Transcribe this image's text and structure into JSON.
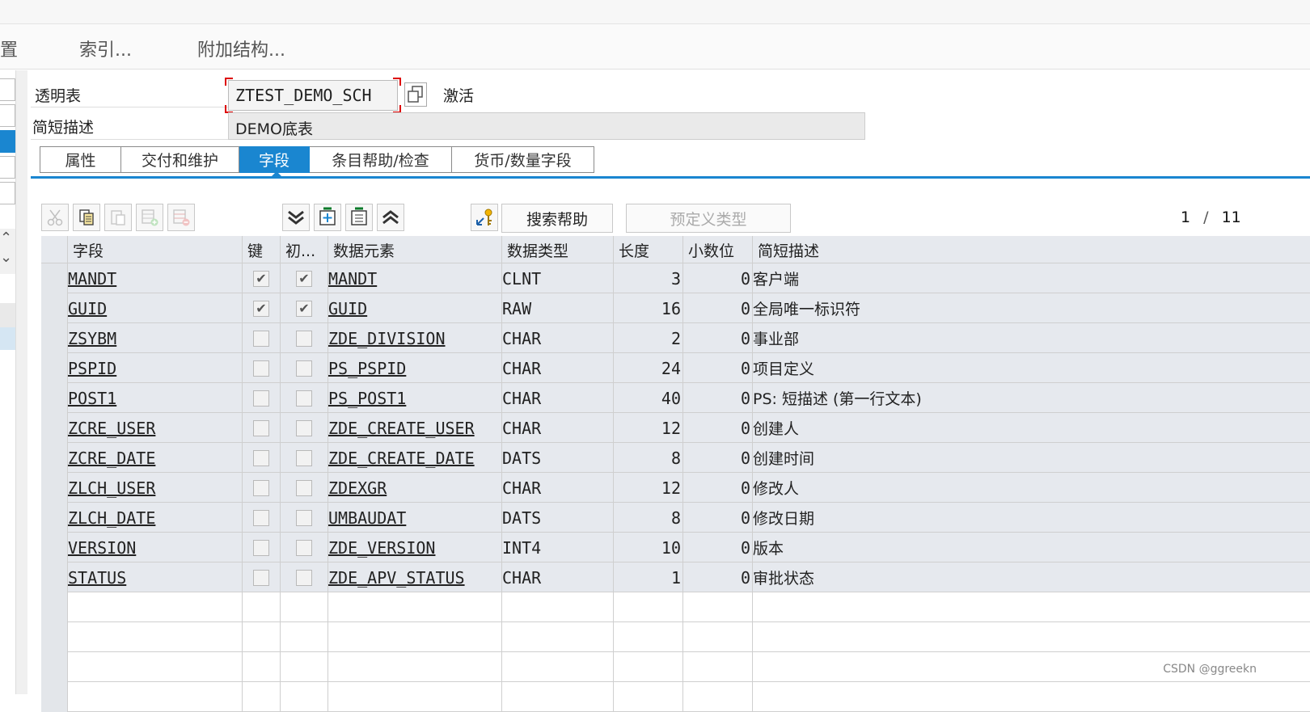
{
  "menu": {
    "items": [
      "置",
      "索引...",
      "附加结构..."
    ]
  },
  "header": {
    "table_label": "透明表",
    "table_name": "ZTEST_DEMO_SCH",
    "status": "激活",
    "desc_label": "简短描述",
    "desc_value": "DEMO底表"
  },
  "tabs": [
    "属性",
    "交付和维护",
    "字段",
    "条目帮助/检查",
    "货币/数量字段"
  ],
  "active_tab": "字段",
  "toolbar": {
    "icons": [
      "cut-icon",
      "copy-icon",
      "paste-icon",
      "insert-row-icon",
      "delete-row-icon",
      "scroll-bottom-icon",
      "new-field-icon",
      "details-icon",
      "scroll-top-icon",
      "foreign-key-icon"
    ],
    "search_help": "搜索帮助",
    "predefined_type": "预定义类型",
    "page_current": "1",
    "page_sep": "/",
    "page_total": "11"
  },
  "columns": [
    "字段",
    "键",
    "初...",
    "数据元素",
    "数据类型",
    "长度",
    "小数位",
    "简短描述"
  ],
  "rows": [
    {
      "field": "MANDT",
      "key": true,
      "init": true,
      "element": "MANDT",
      "type": "CLNT",
      "length": "3",
      "decimals": "0",
      "desc": "客户端"
    },
    {
      "field": "GUID",
      "key": true,
      "init": true,
      "element": "GUID",
      "type": "RAW",
      "length": "16",
      "decimals": "0",
      "desc": "全局唯一标识符"
    },
    {
      "field": "ZSYBM",
      "key": false,
      "init": false,
      "element": "ZDE_DIVISION",
      "type": "CHAR",
      "length": "2",
      "decimals": "0",
      "desc": "事业部"
    },
    {
      "field": "PSPID",
      "key": false,
      "init": false,
      "element": "PS_PSPID",
      "type": "CHAR",
      "length": "24",
      "decimals": "0",
      "desc": "项目定义"
    },
    {
      "field": "POST1",
      "key": false,
      "init": false,
      "element": "PS_POST1",
      "type": "CHAR",
      "length": "40",
      "decimals": "0",
      "desc": "PS: 短描述 (第一行文本)"
    },
    {
      "field": "ZCRE_USER",
      "key": false,
      "init": false,
      "element": "ZDE_CREATE_USER",
      "type": "CHAR",
      "length": "12",
      "decimals": "0",
      "desc": "创建人"
    },
    {
      "field": "ZCRE_DATE",
      "key": false,
      "init": false,
      "element": "ZDE_CREATE_DATE",
      "type": "DATS",
      "length": "8",
      "decimals": "0",
      "desc": "创建时间"
    },
    {
      "field": "ZLCH_USER",
      "key": false,
      "init": false,
      "element": "ZDEXGR",
      "type": "CHAR",
      "length": "12",
      "decimals": "0",
      "desc": "修改人"
    },
    {
      "field": "ZLCH_DATE",
      "key": false,
      "init": false,
      "element": "UMBAUDAT",
      "type": "DATS",
      "length": "8",
      "decimals": "0",
      "desc": "修改日期"
    },
    {
      "field": "VERSION",
      "key": false,
      "init": false,
      "element": "ZDE_VERSION",
      "type": "INT4",
      "length": "10",
      "decimals": "0",
      "desc": "版本"
    },
    {
      "field": "STATUS",
      "key": false,
      "init": false,
      "element": "ZDE_APV_STATUS",
      "type": "CHAR",
      "length": "1",
      "decimals": "0",
      "desc": "审批状态"
    }
  ],
  "watermark": "CSDN @ggreekn",
  "colors": {
    "accent": "#1a86d0",
    "row_bg": "#e6e9ee",
    "required_marker": "#dd0000"
  }
}
